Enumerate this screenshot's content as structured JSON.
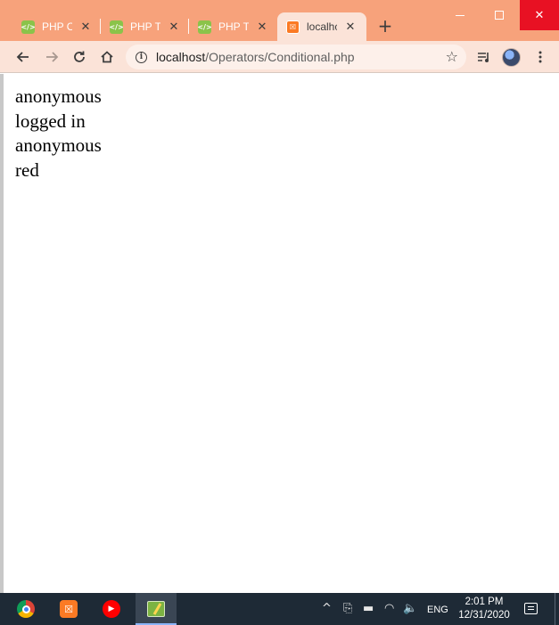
{
  "browser": {
    "tabs": [
      {
        "title": "PHP O",
        "favicon": "php-icon",
        "active": false
      },
      {
        "title": "PHP Tr",
        "favicon": "php-icon",
        "active": false
      },
      {
        "title": "PHP Tr",
        "favicon": "php-icon",
        "active": false
      },
      {
        "title": "localhc",
        "favicon": "xampp-icon",
        "active": true
      }
    ],
    "close_glyph": "✕",
    "new_tab_glyph": "+",
    "favicon_text": "</>",
    "address": {
      "host": "localhost",
      "path": "/Operators/Conditional.php"
    }
  },
  "page": {
    "lines": [
      "anonymous",
      "logged in",
      "anonymous",
      "red"
    ]
  },
  "taskbar": {
    "apps": [
      "chrome-icon",
      "xampp-icon",
      "youtube-music-icon",
      "notepad-icon"
    ],
    "language": "ENG",
    "time": "2:01 PM",
    "date": "12/31/2020"
  },
  "colors": {
    "tab_strip": "#f7a27b",
    "toolbar": "#fbe3d8",
    "close_button": "#e81123",
    "taskbar": "#1e2a36"
  }
}
